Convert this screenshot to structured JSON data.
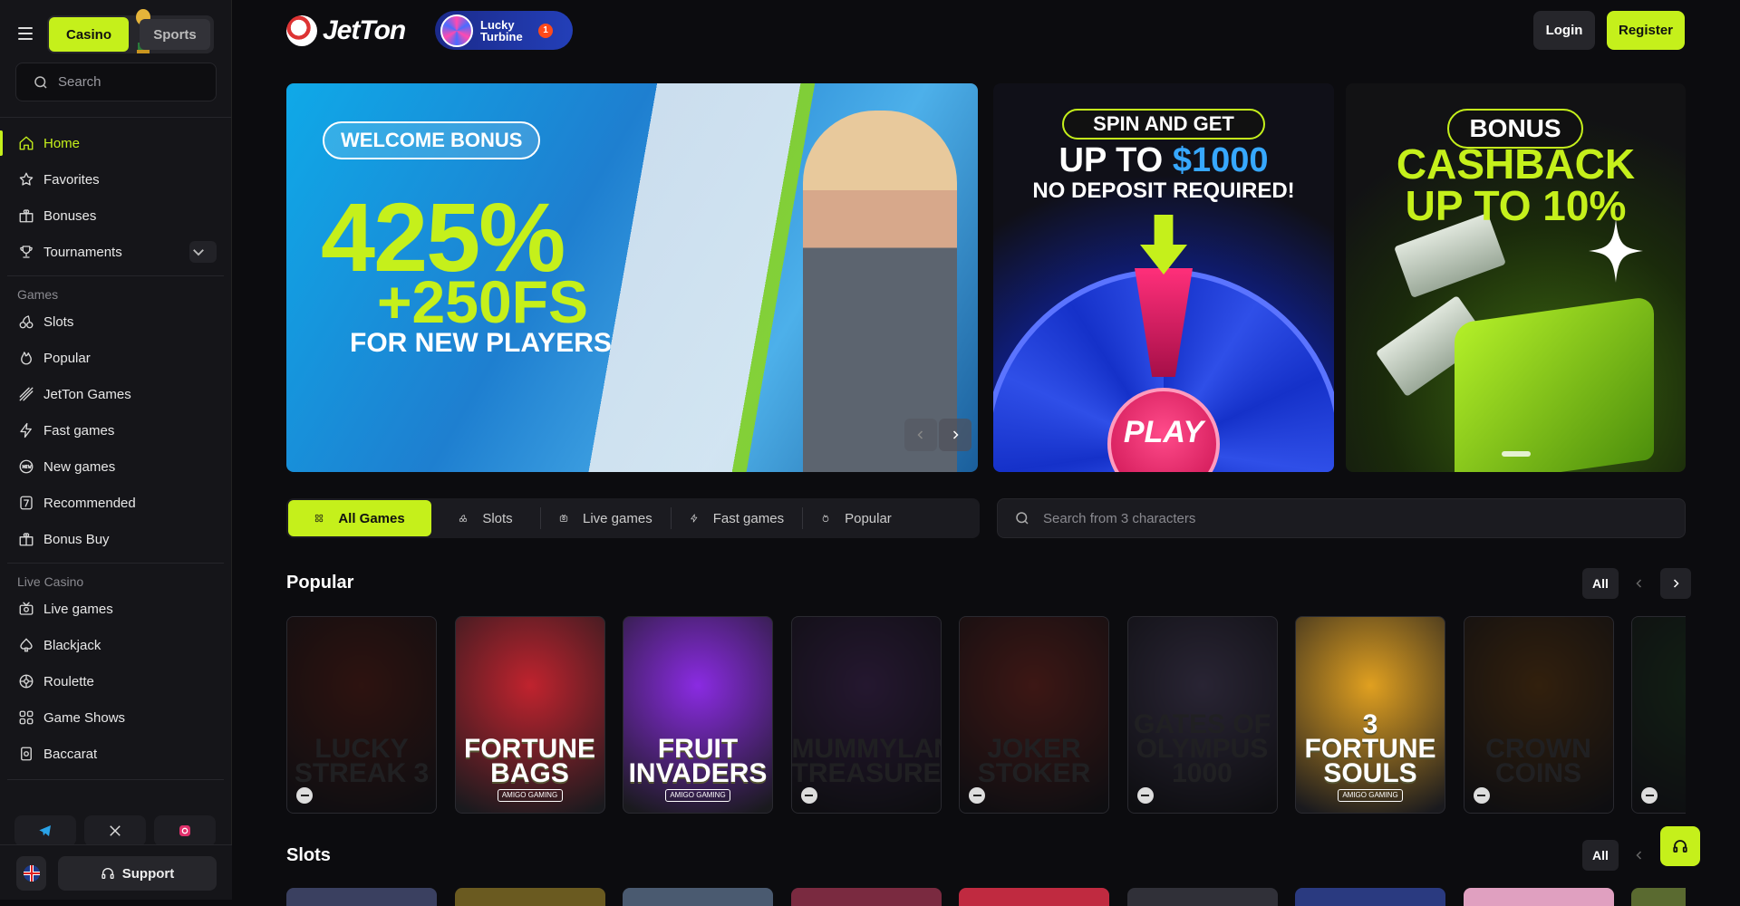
{
  "sidebar": {
    "switcher": {
      "casino": "Casino",
      "sports": "Sports"
    },
    "search_placeholder": "Search",
    "main_items": [
      {
        "label": "Home",
        "icon": "home-icon",
        "active": true
      },
      {
        "label": "Favorites",
        "icon": "star-icon"
      },
      {
        "label": "Bonuses",
        "icon": "gift-icon"
      },
      {
        "label": "Tournaments",
        "icon": "trophy-icon",
        "expandable": true
      }
    ],
    "games_label": "Games",
    "games_items": [
      {
        "label": "Slots",
        "icon": "cherries-icon"
      },
      {
        "label": "Popular",
        "icon": "flame-icon"
      },
      {
        "label": "JetTon Games",
        "icon": "jet-icon"
      },
      {
        "label": "Fast games",
        "icon": "lightning-icon"
      },
      {
        "label": "New games",
        "icon": "new-badge-icon"
      },
      {
        "label": "Recommended",
        "icon": "seven-icon"
      },
      {
        "label": "Bonus Buy",
        "icon": "gift-icon"
      }
    ],
    "live_label": "Live Casino",
    "live_items": [
      {
        "label": "Live games",
        "icon": "tv-icon"
      },
      {
        "label": "Blackjack",
        "icon": "spade-icon"
      },
      {
        "label": "Roulette",
        "icon": "roulette-icon"
      },
      {
        "label": "Game Shows",
        "icon": "grid-icon"
      },
      {
        "label": "Baccarat",
        "icon": "card-icon"
      }
    ],
    "socials": [
      "telegram-icon",
      "x-icon",
      "instagram-icon"
    ],
    "support_label": "Support"
  },
  "header": {
    "logo_text": "JetTon",
    "lucky_turbine": {
      "text": "Lucky\nTurbine",
      "badge": "1"
    },
    "login": "Login",
    "register": "Register"
  },
  "banners": {
    "welcome": {
      "pill": "WELCOME BONUS",
      "big": "425%",
      "fs": "+250FS",
      "sub": "FOR NEW PLAYERS"
    },
    "spin": {
      "pill": "SPIN AND GET",
      "line2_prefix": "UP TO ",
      "line2_amount": "$1000",
      "line3": "NO DEPOSIT REQUIRED!",
      "play": "PLAY"
    },
    "cashback": {
      "pill": "BONUS",
      "line2": "CASHBACK\nUP TO 10%"
    }
  },
  "filters": {
    "tabs": [
      {
        "label": "All Games",
        "icon": "grid-icon",
        "active": true
      },
      {
        "label": "Slots",
        "icon": "cherries-icon"
      },
      {
        "label": "Live games",
        "icon": "tv-icon"
      },
      {
        "label": "Fast games",
        "icon": "lightning-icon"
      },
      {
        "label": "Popular",
        "icon": "flame-icon"
      }
    ],
    "search_placeholder": "Search from 3 characters"
  },
  "sections": {
    "popular": {
      "title": "Popular",
      "all": "All"
    },
    "slots": {
      "title": "Slots",
      "all": "All"
    }
  },
  "popular_games": [
    {
      "title": "LUCKY STREAK 3",
      "provider": "",
      "available": false,
      "color": "#8a2b1b"
    },
    {
      "title": "FORTUNE BAGS",
      "provider": "AMIGO GAMING",
      "available": true,
      "color": "#c0232e"
    },
    {
      "title": "FRUIT INVADERS",
      "provider": "AMIGO GAMING",
      "available": true,
      "color": "#8a2be2"
    },
    {
      "title": "MUMMYLAND TREASURES",
      "provider": "",
      "available": false,
      "color": "#6a3b8a"
    },
    {
      "title": "JOKER STOKER",
      "provider": "",
      "available": false,
      "color": "#c03a2b"
    },
    {
      "title": "GATES OF OLYMPUS 1000",
      "provider": "",
      "available": false,
      "color": "#7a6a9a"
    },
    {
      "title": "3 FORTUNE SOULS",
      "provider": "AMIGO GAMING",
      "available": true,
      "color": "#e0a020"
    },
    {
      "title": "CROWN COINS",
      "provider": "",
      "available": false,
      "color": "#9a5a10"
    },
    {
      "title": "",
      "provider": "",
      "available": false,
      "color": "#2a5a2a"
    }
  ],
  "slots_colors": [
    "#3a4060",
    "#6a5a20",
    "#4a5a70",
    "#7a2a40",
    "#c02a40",
    "#303038",
    "#2a3a80",
    "#e0a0c0",
    "#5a6a30"
  ],
  "colors": {
    "accent": "#c5f01b",
    "bg": "#0c0c0f",
    "panel": "#151519"
  }
}
